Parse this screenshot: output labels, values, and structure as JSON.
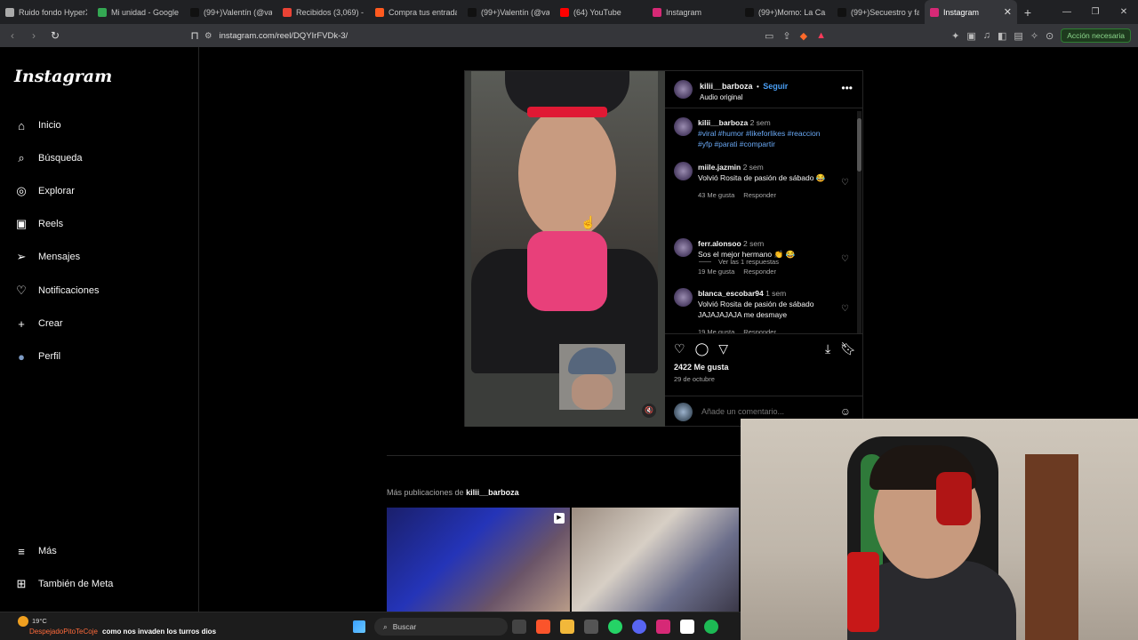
{
  "browser": {
    "tabs": [
      {
        "title": "Ruido fondo HyperX",
        "icon": "gear-icon",
        "color": "#aaaaaa"
      },
      {
        "title": "Mi unidad - Google",
        "icon": "drive-icon",
        "color": "#34a853"
      },
      {
        "title": "(99+)Valentín (@va",
        "icon": "tiktok-icon",
        "color": "#111111"
      },
      {
        "title": "Recibidos (3,069) -",
        "icon": "gmail-icon",
        "color": "#ea4335"
      },
      {
        "title": "Compra tus entrada",
        "icon": "ticket-icon",
        "color": "#ff5a1f"
      },
      {
        "title": "(99+)Valentín (@va",
        "icon": "tiktok-icon",
        "color": "#111111"
      },
      {
        "title": "(64) YouTube",
        "icon": "youtube-icon",
        "color": "#ff0000"
      },
      {
        "title": "Instagram",
        "icon": "instagram-icon",
        "color": "#d62976"
      },
      {
        "title": "(99+)Momo: La Ca",
        "icon": "tiktok-icon",
        "color": "#111111"
      },
      {
        "title": "(99+)Secuestro y fa",
        "icon": "tiktok-icon",
        "color": "#111111"
      },
      {
        "title": "Instagram",
        "icon": "instagram-icon",
        "color": "#d62976",
        "active": true
      }
    ],
    "url": "instagram.com/reel/DQYIrFVDk-3/",
    "action_button": "Acción necesaria"
  },
  "sidebar": {
    "logo": "Instagram",
    "items": [
      {
        "label": "Inicio",
        "icon": "home-icon"
      },
      {
        "label": "Búsqueda",
        "icon": "search-icon"
      },
      {
        "label": "Explorar",
        "icon": "compass-icon"
      },
      {
        "label": "Reels",
        "icon": "reels-icon"
      },
      {
        "label": "Mensajes",
        "icon": "send-icon"
      },
      {
        "label": "Notificaciones",
        "icon": "heart-icon"
      },
      {
        "label": "Crear",
        "icon": "plus-icon"
      },
      {
        "label": "Perfil",
        "icon": "avatar-icon"
      }
    ],
    "bottom": [
      {
        "label": "Más",
        "icon": "menu-icon"
      },
      {
        "label": "También de Meta",
        "icon": "grid-icon"
      }
    ]
  },
  "post": {
    "username": "kilii__barboza",
    "separator": "•",
    "follow": "Seguir",
    "audio": "Audio original",
    "caption": {
      "username": "kilii__barboza",
      "time": "2 sem",
      "tags": "#viral #humor #likeforlikes #reaccion #yfp #parati #compartir"
    },
    "comments": [
      {
        "username": "miile.jazmin",
        "time": "2 sem",
        "text": "Volvió Rosita de pasión de sábado 😂",
        "likes": "43 Me gusta",
        "reply": "Responder"
      },
      {
        "username": "ferr.alonsoo",
        "time": "2 sem",
        "text": "Sos el mejor hermano 👏 😂",
        "likes": "19 Me gusta",
        "reply": "Responder"
      },
      {
        "username": "blanca_escobar94",
        "time": "1 sem",
        "text": "Volvió Rosita de pasión de sábado JAJAJAJAJA me desmaye",
        "likes": "19 Me gusta",
        "reply": "Responder"
      }
    ],
    "view_replies": "Ver las 1 respuestas",
    "likes": "2422 Me gusta",
    "date": "29 de octubre",
    "add_comment_placeholder": "Añade un comentario..."
  },
  "more": {
    "label": "Más publicaciones de",
    "username": "kilii__barboza"
  },
  "taskbar": {
    "temperature": "19°C",
    "ticker_name": "DespejadoPitoTeCoje",
    "ticker_text": "como nos invaden los turros dios",
    "search": "Buscar"
  }
}
